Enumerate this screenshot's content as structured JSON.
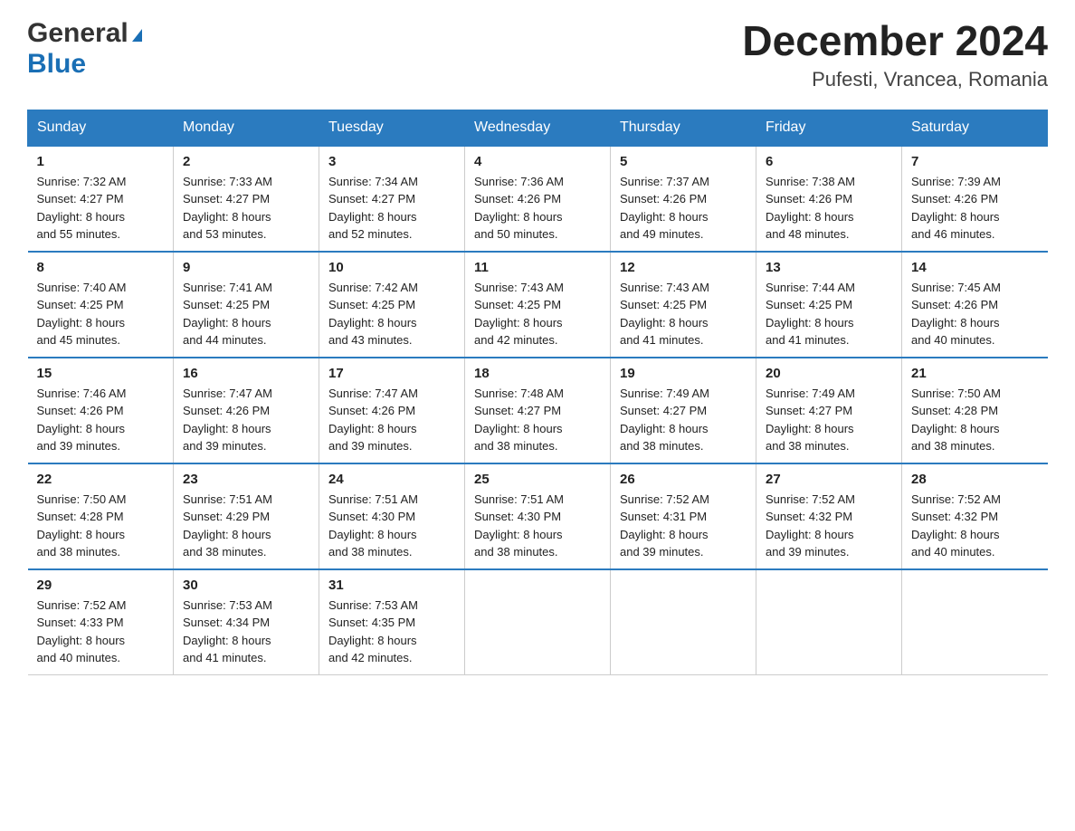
{
  "logo": {
    "general": "General",
    "blue": "Blue"
  },
  "title": {
    "month_year": "December 2024",
    "location": "Pufesti, Vrancea, Romania"
  },
  "days_of_week": [
    "Sunday",
    "Monday",
    "Tuesday",
    "Wednesday",
    "Thursday",
    "Friday",
    "Saturday"
  ],
  "weeks": [
    [
      {
        "day": "1",
        "sunrise": "7:32 AM",
        "sunset": "4:27 PM",
        "daylight": "8 hours and 55 minutes."
      },
      {
        "day": "2",
        "sunrise": "7:33 AM",
        "sunset": "4:27 PM",
        "daylight": "8 hours and 53 minutes."
      },
      {
        "day": "3",
        "sunrise": "7:34 AM",
        "sunset": "4:27 PM",
        "daylight": "8 hours and 52 minutes."
      },
      {
        "day": "4",
        "sunrise": "7:36 AM",
        "sunset": "4:26 PM",
        "daylight": "8 hours and 50 minutes."
      },
      {
        "day": "5",
        "sunrise": "7:37 AM",
        "sunset": "4:26 PM",
        "daylight": "8 hours and 49 minutes."
      },
      {
        "day": "6",
        "sunrise": "7:38 AM",
        "sunset": "4:26 PM",
        "daylight": "8 hours and 48 minutes."
      },
      {
        "day": "7",
        "sunrise": "7:39 AM",
        "sunset": "4:26 PM",
        "daylight": "8 hours and 46 minutes."
      }
    ],
    [
      {
        "day": "8",
        "sunrise": "7:40 AM",
        "sunset": "4:25 PM",
        "daylight": "8 hours and 45 minutes."
      },
      {
        "day": "9",
        "sunrise": "7:41 AM",
        "sunset": "4:25 PM",
        "daylight": "8 hours and 44 minutes."
      },
      {
        "day": "10",
        "sunrise": "7:42 AM",
        "sunset": "4:25 PM",
        "daylight": "8 hours and 43 minutes."
      },
      {
        "day": "11",
        "sunrise": "7:43 AM",
        "sunset": "4:25 PM",
        "daylight": "8 hours and 42 minutes."
      },
      {
        "day": "12",
        "sunrise": "7:43 AM",
        "sunset": "4:25 PM",
        "daylight": "8 hours and 41 minutes."
      },
      {
        "day": "13",
        "sunrise": "7:44 AM",
        "sunset": "4:25 PM",
        "daylight": "8 hours and 41 minutes."
      },
      {
        "day": "14",
        "sunrise": "7:45 AM",
        "sunset": "4:26 PM",
        "daylight": "8 hours and 40 minutes."
      }
    ],
    [
      {
        "day": "15",
        "sunrise": "7:46 AM",
        "sunset": "4:26 PM",
        "daylight": "8 hours and 39 minutes."
      },
      {
        "day": "16",
        "sunrise": "7:47 AM",
        "sunset": "4:26 PM",
        "daylight": "8 hours and 39 minutes."
      },
      {
        "day": "17",
        "sunrise": "7:47 AM",
        "sunset": "4:26 PM",
        "daylight": "8 hours and 39 minutes."
      },
      {
        "day": "18",
        "sunrise": "7:48 AM",
        "sunset": "4:27 PM",
        "daylight": "8 hours and 38 minutes."
      },
      {
        "day": "19",
        "sunrise": "7:49 AM",
        "sunset": "4:27 PM",
        "daylight": "8 hours and 38 minutes."
      },
      {
        "day": "20",
        "sunrise": "7:49 AM",
        "sunset": "4:27 PM",
        "daylight": "8 hours and 38 minutes."
      },
      {
        "day": "21",
        "sunrise": "7:50 AM",
        "sunset": "4:28 PM",
        "daylight": "8 hours and 38 minutes."
      }
    ],
    [
      {
        "day": "22",
        "sunrise": "7:50 AM",
        "sunset": "4:28 PM",
        "daylight": "8 hours and 38 minutes."
      },
      {
        "day": "23",
        "sunrise": "7:51 AM",
        "sunset": "4:29 PM",
        "daylight": "8 hours and 38 minutes."
      },
      {
        "day": "24",
        "sunrise": "7:51 AM",
        "sunset": "4:30 PM",
        "daylight": "8 hours and 38 minutes."
      },
      {
        "day": "25",
        "sunrise": "7:51 AM",
        "sunset": "4:30 PM",
        "daylight": "8 hours and 38 minutes."
      },
      {
        "day": "26",
        "sunrise": "7:52 AM",
        "sunset": "4:31 PM",
        "daylight": "8 hours and 39 minutes."
      },
      {
        "day": "27",
        "sunrise": "7:52 AM",
        "sunset": "4:32 PM",
        "daylight": "8 hours and 39 minutes."
      },
      {
        "day": "28",
        "sunrise": "7:52 AM",
        "sunset": "4:32 PM",
        "daylight": "8 hours and 40 minutes."
      }
    ],
    [
      {
        "day": "29",
        "sunrise": "7:52 AM",
        "sunset": "4:33 PM",
        "daylight": "8 hours and 40 minutes."
      },
      {
        "day": "30",
        "sunrise": "7:53 AM",
        "sunset": "4:34 PM",
        "daylight": "8 hours and 41 minutes."
      },
      {
        "day": "31",
        "sunrise": "7:53 AM",
        "sunset": "4:35 PM",
        "daylight": "8 hours and 42 minutes."
      },
      null,
      null,
      null,
      null
    ]
  ],
  "labels": {
    "sunrise": "Sunrise:",
    "sunset": "Sunset:",
    "daylight": "Daylight:"
  }
}
